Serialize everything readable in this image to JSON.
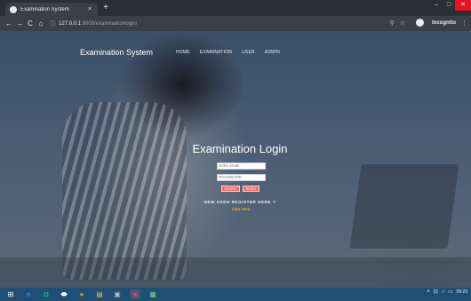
{
  "browser": {
    "tab_title": "Examination System",
    "tab_close": "×",
    "new_tab": "+",
    "url_host": "127.0.0.1",
    "url_path": ":8000/examinationlogin/",
    "mode_label": "Incognito",
    "window_controls": [
      "–",
      "□",
      "✕"
    ],
    "nav_icons": [
      "←",
      "→",
      "C",
      "⌂"
    ],
    "info_icon": "ⓘ",
    "toolbar_icons": [
      "⚲",
      "☆"
    ],
    "menu_icon": "⋮"
  },
  "site": {
    "brand": "Examination System",
    "nav": [
      "HOME",
      "EXAMINATION",
      "USER",
      "ADMIN"
    ]
  },
  "login": {
    "title": "Examination Login",
    "email_placeholder": "Enter email",
    "password_placeholder": "PASSWORD",
    "submit_label": "SUBMIT",
    "reset_label": "RESET",
    "register_question": "NEW USER REGISTER HERE ?",
    "register_link": "Click Here"
  },
  "taskbar": {
    "icons": [
      "⊞",
      "e",
      "◘",
      "⬬",
      "●",
      "▤",
      "▣",
      "◉",
      "▦"
    ],
    "tray_icons": [
      "˄",
      "⊡",
      "♪",
      "▭"
    ],
    "time": "09:29"
  }
}
